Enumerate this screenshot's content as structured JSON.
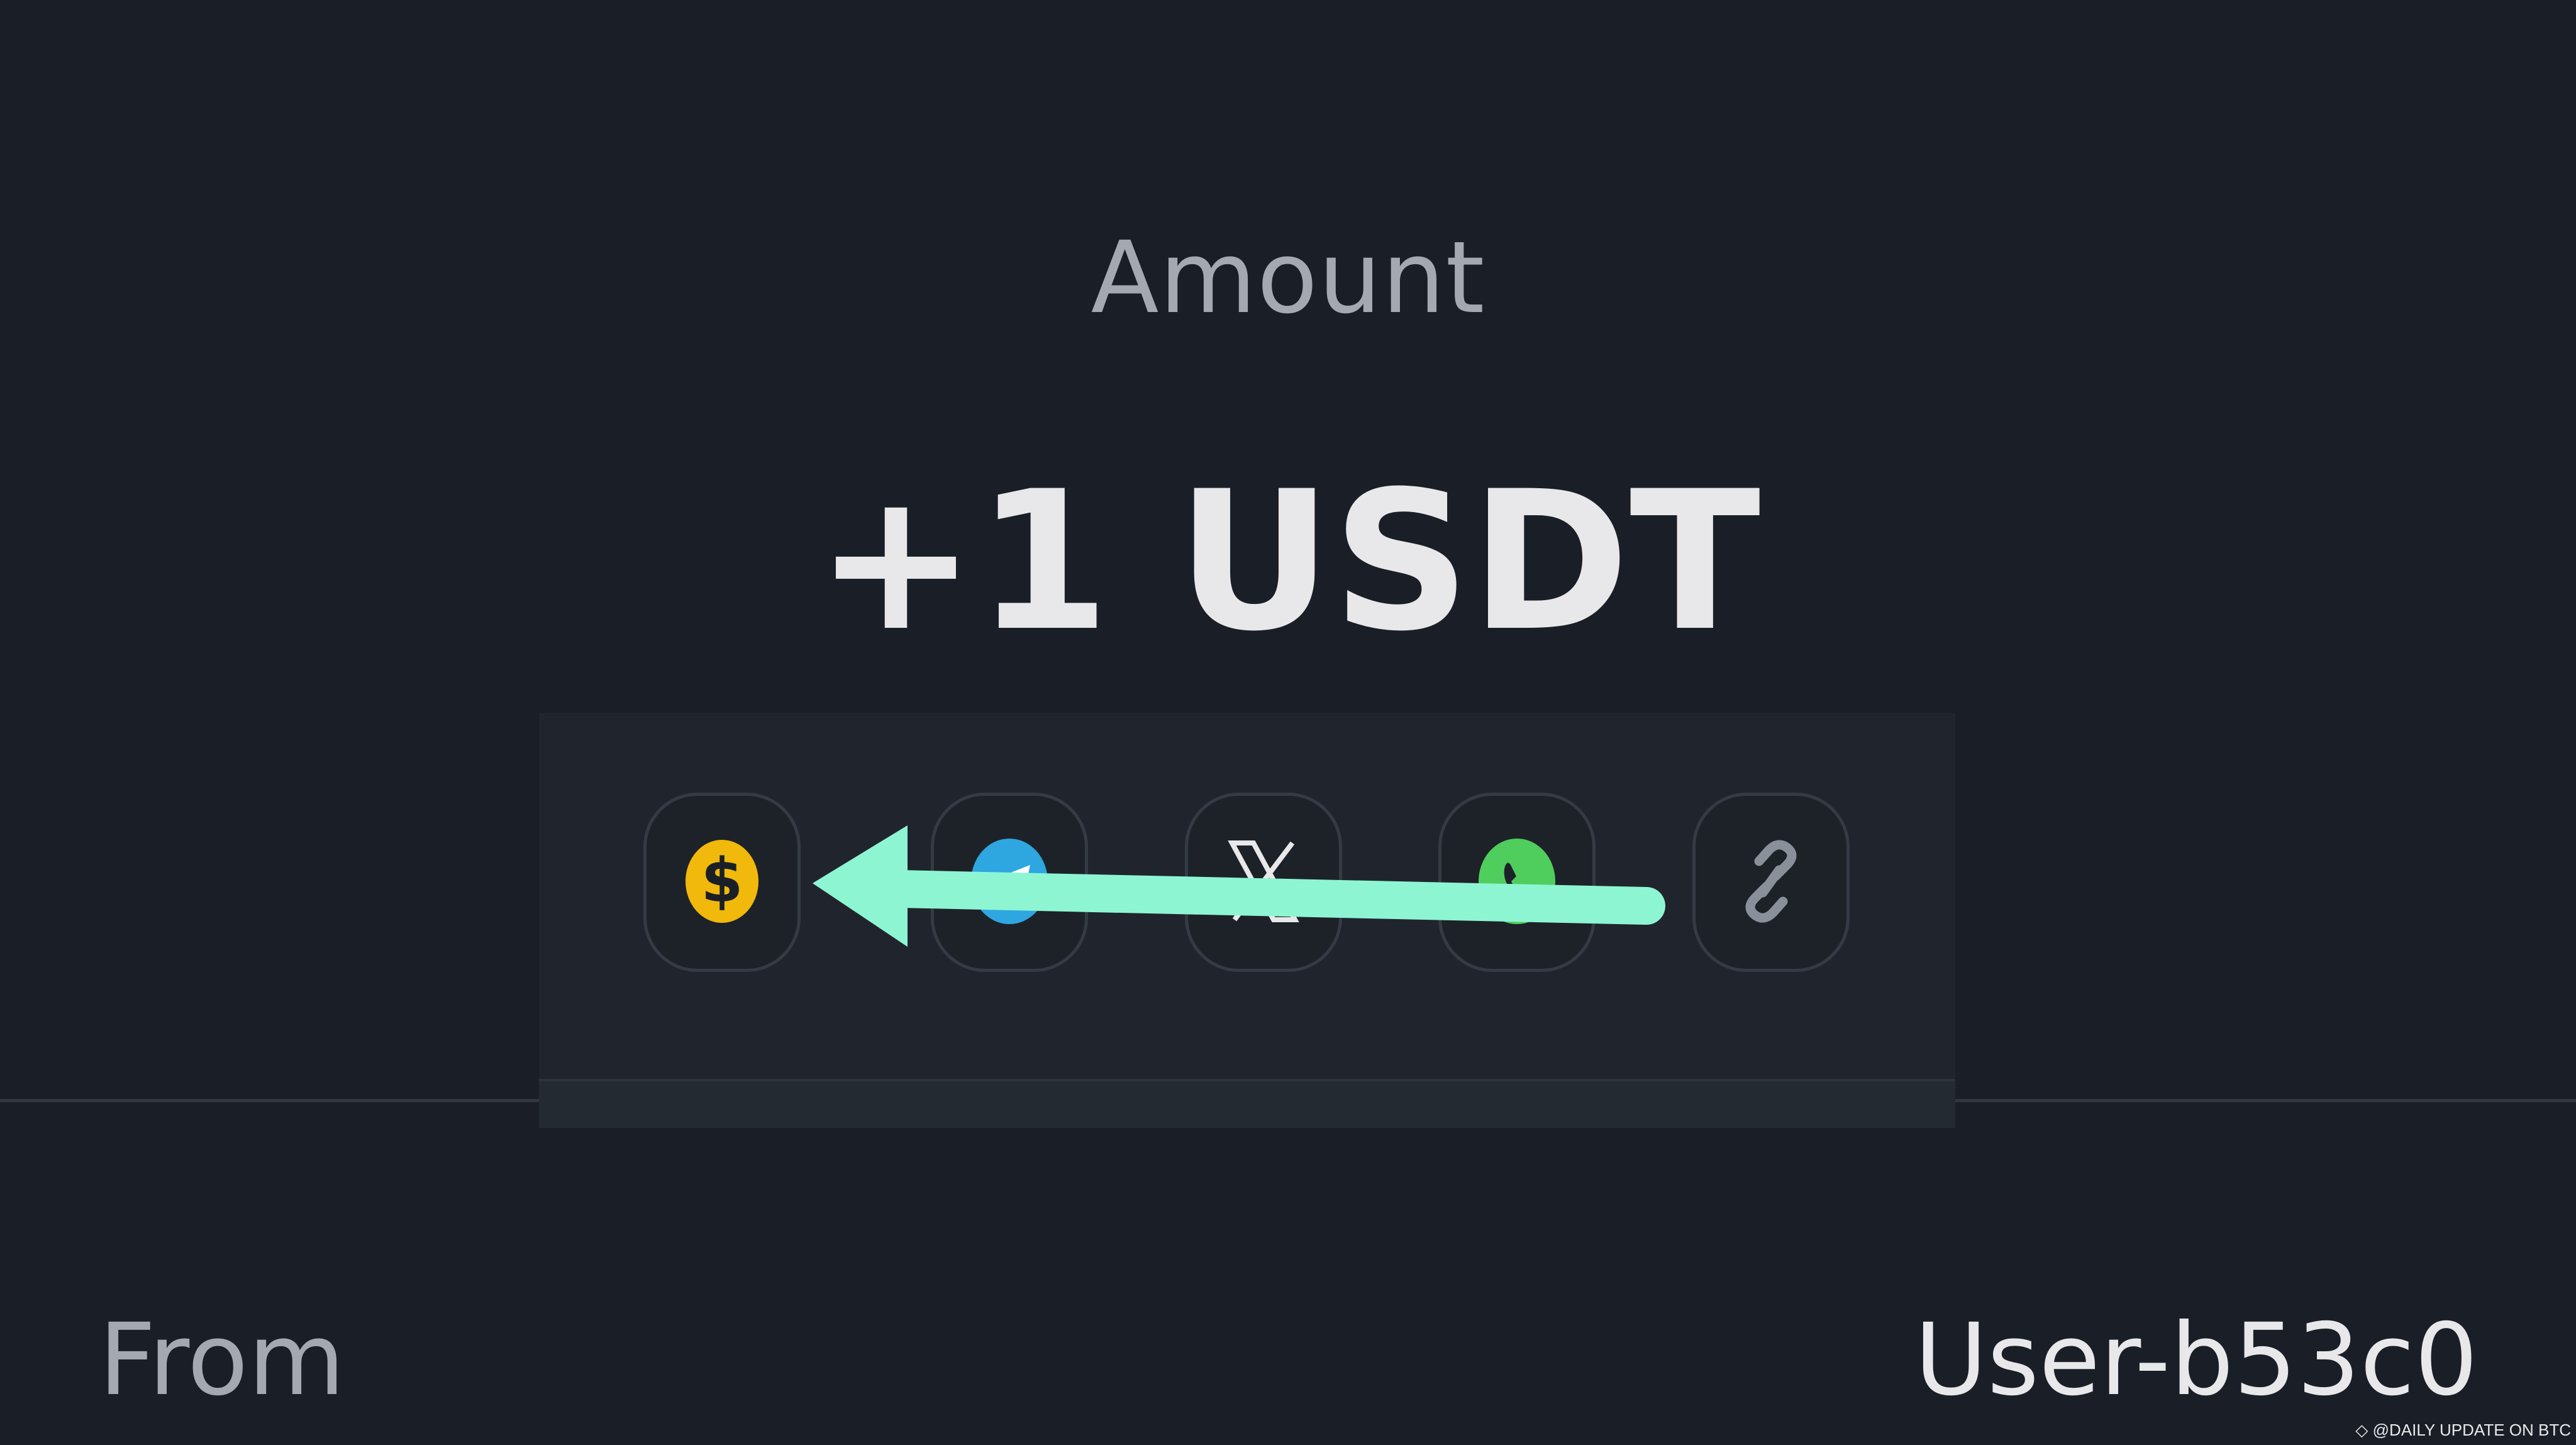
{
  "amount": {
    "label": "Amount",
    "value": "+1 USDT"
  },
  "share": {
    "buttons": [
      {
        "icon": "dollar-coin-icon"
      },
      {
        "icon": "telegram-icon"
      },
      {
        "icon": "x-icon"
      },
      {
        "icon": "whatsapp-icon"
      },
      {
        "icon": "link-icon"
      }
    ]
  },
  "details": {
    "from_label": "From",
    "from_value": "User-b53c0"
  },
  "watermark": "@DAILY UPDATE ON BTC",
  "colors": {
    "background": "#1a1f27",
    "panel": "#20252d",
    "coin": "#f0b90b",
    "telegram": "#2ea6e0",
    "whatsapp": "#4fce5d",
    "arrow": "#8ef5d3"
  }
}
